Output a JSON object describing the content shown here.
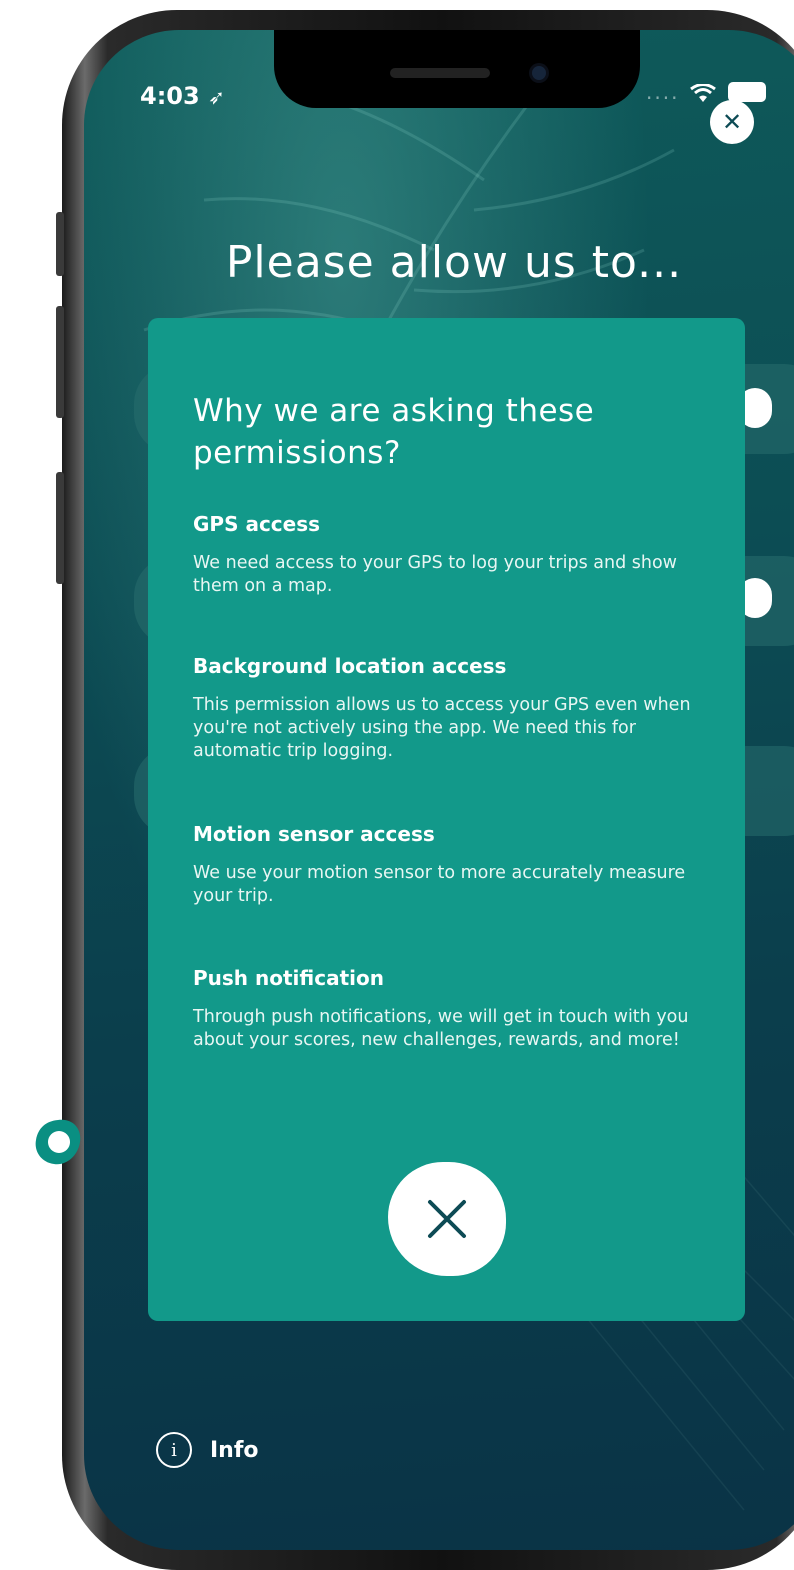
{
  "status_bar": {
    "time": "4:03",
    "signal": "....",
    "wifi_icon": "wifi-icon",
    "battery_icon": "battery-icon"
  },
  "page": {
    "title": "Please allow us to..."
  },
  "modal": {
    "title": "Why we are asking these permissions?",
    "sections": [
      {
        "title": "GPS access",
        "body": "We need access to your GPS to log your trips and show them on a map."
      },
      {
        "title": "Background location access",
        "body": "This permission allows us to access your GPS even when you're not actively using the app. We need this for automatic trip logging."
      },
      {
        "title": "Motion sensor access",
        "body": "We use your motion sensor to more accurately measure your trip."
      },
      {
        "title": "Push notification",
        "body": "Through push notifications, we will get in touch with you about your scores, new challenges, rewards, and more!"
      }
    ]
  },
  "footer": {
    "info_label": "Info",
    "info_glyph": "i"
  },
  "colors": {
    "modal_bg": "#12998a",
    "screen_bg": "#0c4d54",
    "close_x": "#0d4b55",
    "accent_ring": "#0a8f82"
  }
}
